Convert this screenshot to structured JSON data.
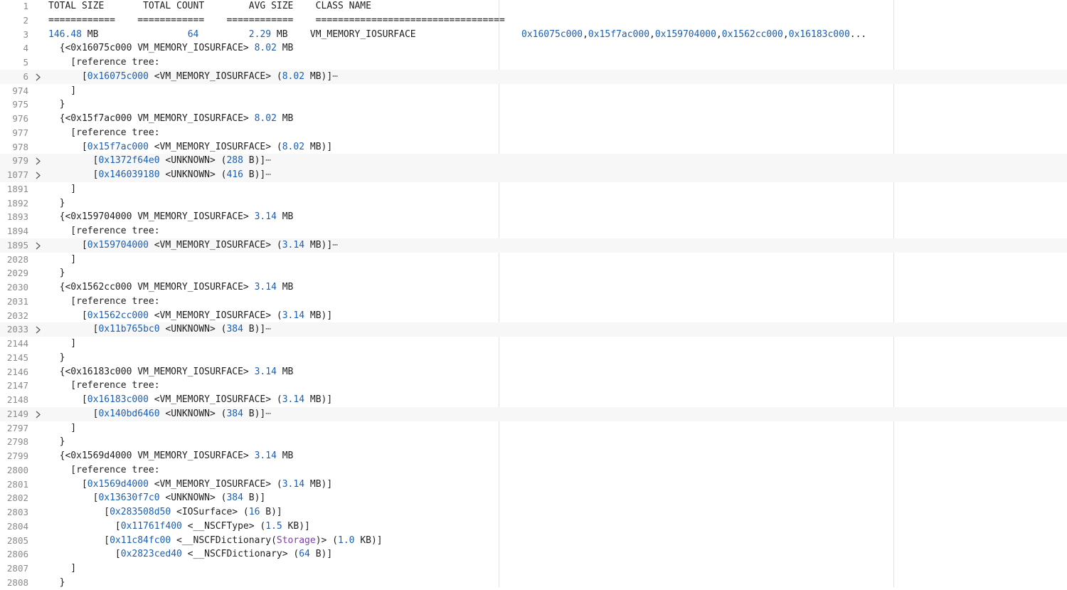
{
  "editor": {
    "ruler_positions": [
      "col-56",
      "col-100"
    ],
    "lines": [
      {
        "n": "1",
        "segs": [
          {
            "t": "TOTAL SIZE       TOTAL COUNT        AVG SIZE    CLASS NAME"
          }
        ]
      },
      {
        "n": "2",
        "segs": [
          {
            "t": "============    ============    ============    =================================="
          }
        ]
      },
      {
        "n": "3",
        "segs": [
          {
            "t": "146.48",
            "c": "num"
          },
          {
            "t": " MB                "
          },
          {
            "t": "64",
            "c": "num"
          },
          {
            "t": "         "
          },
          {
            "t": "2.29",
            "c": "num"
          },
          {
            "t": " MB    VM_MEMORY_IOSURFACE"
          }
        ],
        "side": [
          {
            "t": "0x16075c000",
            "c": "hex"
          },
          {
            "t": ","
          },
          {
            "t": "0x15f7ac000",
            "c": "hex"
          },
          {
            "t": ","
          },
          {
            "t": "0x159704000",
            "c": "hex"
          },
          {
            "t": ","
          },
          {
            "t": "0x1562cc000",
            "c": "hex"
          },
          {
            "t": ","
          },
          {
            "t": "0x16183c000",
            "c": "hex"
          },
          {
            "t": "..."
          }
        ]
      },
      {
        "n": "4",
        "segs": [
          {
            "t": "  {<0x16075c000 VM_MEMORY_IOSURFACE> "
          },
          {
            "t": "8.02",
            "c": "num"
          },
          {
            "t": " MB"
          }
        ]
      },
      {
        "n": "5",
        "segs": [
          {
            "t": "    [reference tree:"
          }
        ]
      },
      {
        "n": "6",
        "fold": true,
        "hl": true,
        "segs": [
          {
            "t": "      ["
          },
          {
            "t": "0x16075c000",
            "c": "hex"
          },
          {
            "t": " <VM_MEMORY_IOSURFACE> ("
          },
          {
            "t": "8.02",
            "c": "num"
          },
          {
            "t": " MB)]"
          },
          {
            "t": "⋯",
            "c": "ell"
          }
        ]
      },
      {
        "n": "974",
        "segs": [
          {
            "t": "    ]"
          }
        ]
      },
      {
        "n": "975",
        "segs": [
          {
            "t": "  }"
          }
        ]
      },
      {
        "n": "976",
        "segs": [
          {
            "t": "  {<0x15f7ac000 VM_MEMORY_IOSURFACE> "
          },
          {
            "t": "8.02",
            "c": "num"
          },
          {
            "t": " MB"
          }
        ]
      },
      {
        "n": "977",
        "segs": [
          {
            "t": "    [reference tree:"
          }
        ]
      },
      {
        "n": "978",
        "segs": [
          {
            "t": "      ["
          },
          {
            "t": "0x15f7ac000",
            "c": "hex"
          },
          {
            "t": " <VM_MEMORY_IOSURFACE> ("
          },
          {
            "t": "8.02",
            "c": "num"
          },
          {
            "t": " MB)]"
          }
        ]
      },
      {
        "n": "979",
        "fold": true,
        "hl": true,
        "segs": [
          {
            "t": "        ["
          },
          {
            "t": "0x1372f64e0",
            "c": "hex"
          },
          {
            "t": " <UNKNOWN> ("
          },
          {
            "t": "288",
            "c": "num"
          },
          {
            "t": " B)]"
          },
          {
            "t": "⋯",
            "c": "ell"
          }
        ]
      },
      {
        "n": "1077",
        "fold": true,
        "hl": true,
        "segs": [
          {
            "t": "        ["
          },
          {
            "t": "0x146039180",
            "c": "hex"
          },
          {
            "t": " <UNKNOWN> ("
          },
          {
            "t": "416",
            "c": "num"
          },
          {
            "t": " B)]"
          },
          {
            "t": "⋯",
            "c": "ell"
          }
        ]
      },
      {
        "n": "1891",
        "segs": [
          {
            "t": "    ]"
          }
        ]
      },
      {
        "n": "1892",
        "segs": [
          {
            "t": "  }"
          }
        ]
      },
      {
        "n": "1893",
        "segs": [
          {
            "t": "  {<0x159704000 VM_MEMORY_IOSURFACE> "
          },
          {
            "t": "3.14",
            "c": "num"
          },
          {
            "t": " MB"
          }
        ]
      },
      {
        "n": "1894",
        "segs": [
          {
            "t": "    [reference tree:"
          }
        ]
      },
      {
        "n": "1895",
        "fold": true,
        "hl": true,
        "segs": [
          {
            "t": "      ["
          },
          {
            "t": "0x159704000",
            "c": "hex"
          },
          {
            "t": " <VM_MEMORY_IOSURFACE> ("
          },
          {
            "t": "3.14",
            "c": "num"
          },
          {
            "t": " MB)]"
          },
          {
            "t": "⋯",
            "c": "ell"
          }
        ]
      },
      {
        "n": "2028",
        "segs": [
          {
            "t": "    ]"
          }
        ]
      },
      {
        "n": "2029",
        "segs": [
          {
            "t": "  }"
          }
        ]
      },
      {
        "n": "2030",
        "segs": [
          {
            "t": "  {<0x1562cc000 VM_MEMORY_IOSURFACE> "
          },
          {
            "t": "3.14",
            "c": "num"
          },
          {
            "t": " MB"
          }
        ]
      },
      {
        "n": "2031",
        "segs": [
          {
            "t": "    [reference tree:"
          }
        ]
      },
      {
        "n": "2032",
        "segs": [
          {
            "t": "      ["
          },
          {
            "t": "0x1562cc000",
            "c": "hex"
          },
          {
            "t": " <VM_MEMORY_IOSURFACE> ("
          },
          {
            "t": "3.14",
            "c": "num"
          },
          {
            "t": " MB)]"
          }
        ]
      },
      {
        "n": "2033",
        "fold": true,
        "hl": true,
        "segs": [
          {
            "t": "        ["
          },
          {
            "t": "0x11b765bc0",
            "c": "hex"
          },
          {
            "t": " <UNKNOWN> ("
          },
          {
            "t": "384",
            "c": "num"
          },
          {
            "t": " B)]"
          },
          {
            "t": "⋯",
            "c": "ell"
          }
        ]
      },
      {
        "n": "2144",
        "segs": [
          {
            "t": "    ]"
          }
        ]
      },
      {
        "n": "2145",
        "segs": [
          {
            "t": "  }"
          }
        ]
      },
      {
        "n": "2146",
        "segs": [
          {
            "t": "  {<0x16183c000 VM_MEMORY_IOSURFACE> "
          },
          {
            "t": "3.14",
            "c": "num"
          },
          {
            "t": " MB"
          }
        ]
      },
      {
        "n": "2147",
        "segs": [
          {
            "t": "    [reference tree:"
          }
        ]
      },
      {
        "n": "2148",
        "segs": [
          {
            "t": "      ["
          },
          {
            "t": "0x16183c000",
            "c": "hex"
          },
          {
            "t": " <VM_MEMORY_IOSURFACE> ("
          },
          {
            "t": "3.14",
            "c": "num"
          },
          {
            "t": " MB)]"
          }
        ]
      },
      {
        "n": "2149",
        "fold": true,
        "hl": true,
        "segs": [
          {
            "t": "        ["
          },
          {
            "t": "0x140bd6460",
            "c": "hex"
          },
          {
            "t": " <UNKNOWN> ("
          },
          {
            "t": "384",
            "c": "num"
          },
          {
            "t": " B)]"
          },
          {
            "t": "⋯",
            "c": "ell"
          }
        ]
      },
      {
        "n": "2797",
        "segs": [
          {
            "t": "    ]"
          }
        ]
      },
      {
        "n": "2798",
        "segs": [
          {
            "t": "  }"
          }
        ]
      },
      {
        "n": "2799",
        "segs": [
          {
            "t": "  {<0x1569d4000 VM_MEMORY_IOSURFACE> "
          },
          {
            "t": "3.14",
            "c": "num"
          },
          {
            "t": " MB"
          }
        ]
      },
      {
        "n": "2800",
        "segs": [
          {
            "t": "    [reference tree:"
          }
        ]
      },
      {
        "n": "2801",
        "segs": [
          {
            "t": "      ["
          },
          {
            "t": "0x1569d4000",
            "c": "hex"
          },
          {
            "t": " <VM_MEMORY_IOSURFACE> ("
          },
          {
            "t": "3.14",
            "c": "num"
          },
          {
            "t": " MB)]"
          }
        ]
      },
      {
        "n": "2802",
        "segs": [
          {
            "t": "        ["
          },
          {
            "t": "0x13630f7c0",
            "c": "hex"
          },
          {
            "t": " <UNKNOWN> ("
          },
          {
            "t": "384",
            "c": "num"
          },
          {
            "t": " B)]"
          }
        ]
      },
      {
        "n": "2803",
        "segs": [
          {
            "t": "          ["
          },
          {
            "t": "0x283508d50",
            "c": "hex"
          },
          {
            "t": " <IOSurface> ("
          },
          {
            "t": "16",
            "c": "num"
          },
          {
            "t": " B)]"
          }
        ]
      },
      {
        "n": "2804",
        "segs": [
          {
            "t": "            ["
          },
          {
            "t": "0x11761f400",
            "c": "hex"
          },
          {
            "t": " <__NSCFType> ("
          },
          {
            "t": "1.5",
            "c": "num"
          },
          {
            "t": " KB)]"
          }
        ]
      },
      {
        "n": "2805",
        "segs": [
          {
            "t": "          ["
          },
          {
            "t": "0x11c84fc00",
            "c": "hex"
          },
          {
            "t": " <__NSCFDictionary("
          },
          {
            "t": "Storage",
            "c": "kw"
          },
          {
            "t": ")> ("
          },
          {
            "t": "1.0",
            "c": "num"
          },
          {
            "t": " KB)]"
          }
        ]
      },
      {
        "n": "2806",
        "segs": [
          {
            "t": "            ["
          },
          {
            "t": "0x2823ced40",
            "c": "hex"
          },
          {
            "t": " <__NSCFDictionary> ("
          },
          {
            "t": "64",
            "c": "num"
          },
          {
            "t": " B)]"
          }
        ]
      },
      {
        "n": "2807",
        "segs": [
          {
            "t": "    ]"
          }
        ]
      },
      {
        "n": "2808",
        "segs": [
          {
            "t": "  }"
          }
        ]
      }
    ]
  }
}
